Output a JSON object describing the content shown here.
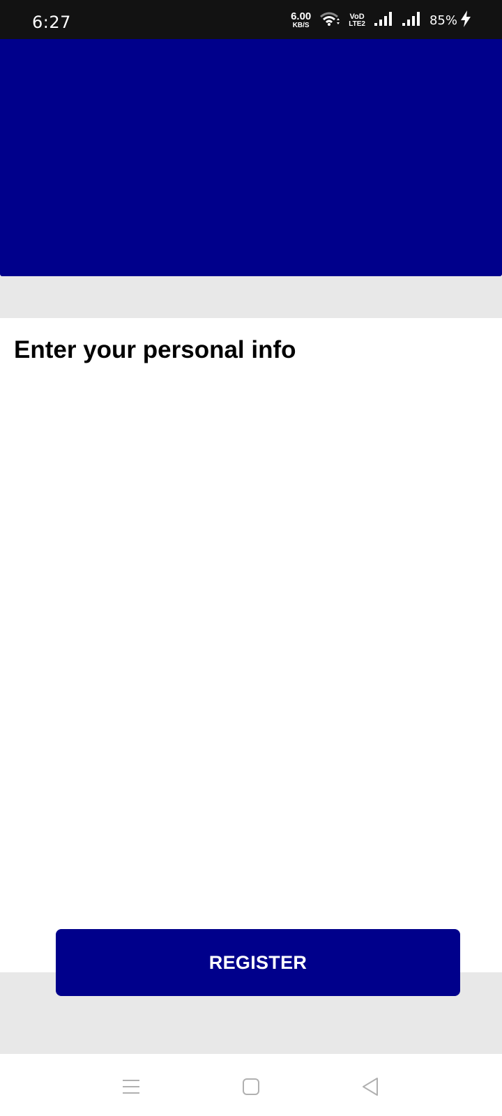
{
  "status_bar": {
    "time": "6:27",
    "net_speed_value": "6.00",
    "net_speed_unit": "KB/S",
    "volte_top": "VoD",
    "volte_bottom": "LTE2",
    "battery_percent": "85%"
  },
  "main": {
    "title": "Enter your personal info",
    "register_label": "REGISTER"
  },
  "colors": {
    "brand": "#00008b",
    "strip": "#e8e8e8"
  },
  "icons": {
    "nav": [
      "menu-icon",
      "home-square-icon",
      "back-triangle-icon"
    ]
  }
}
